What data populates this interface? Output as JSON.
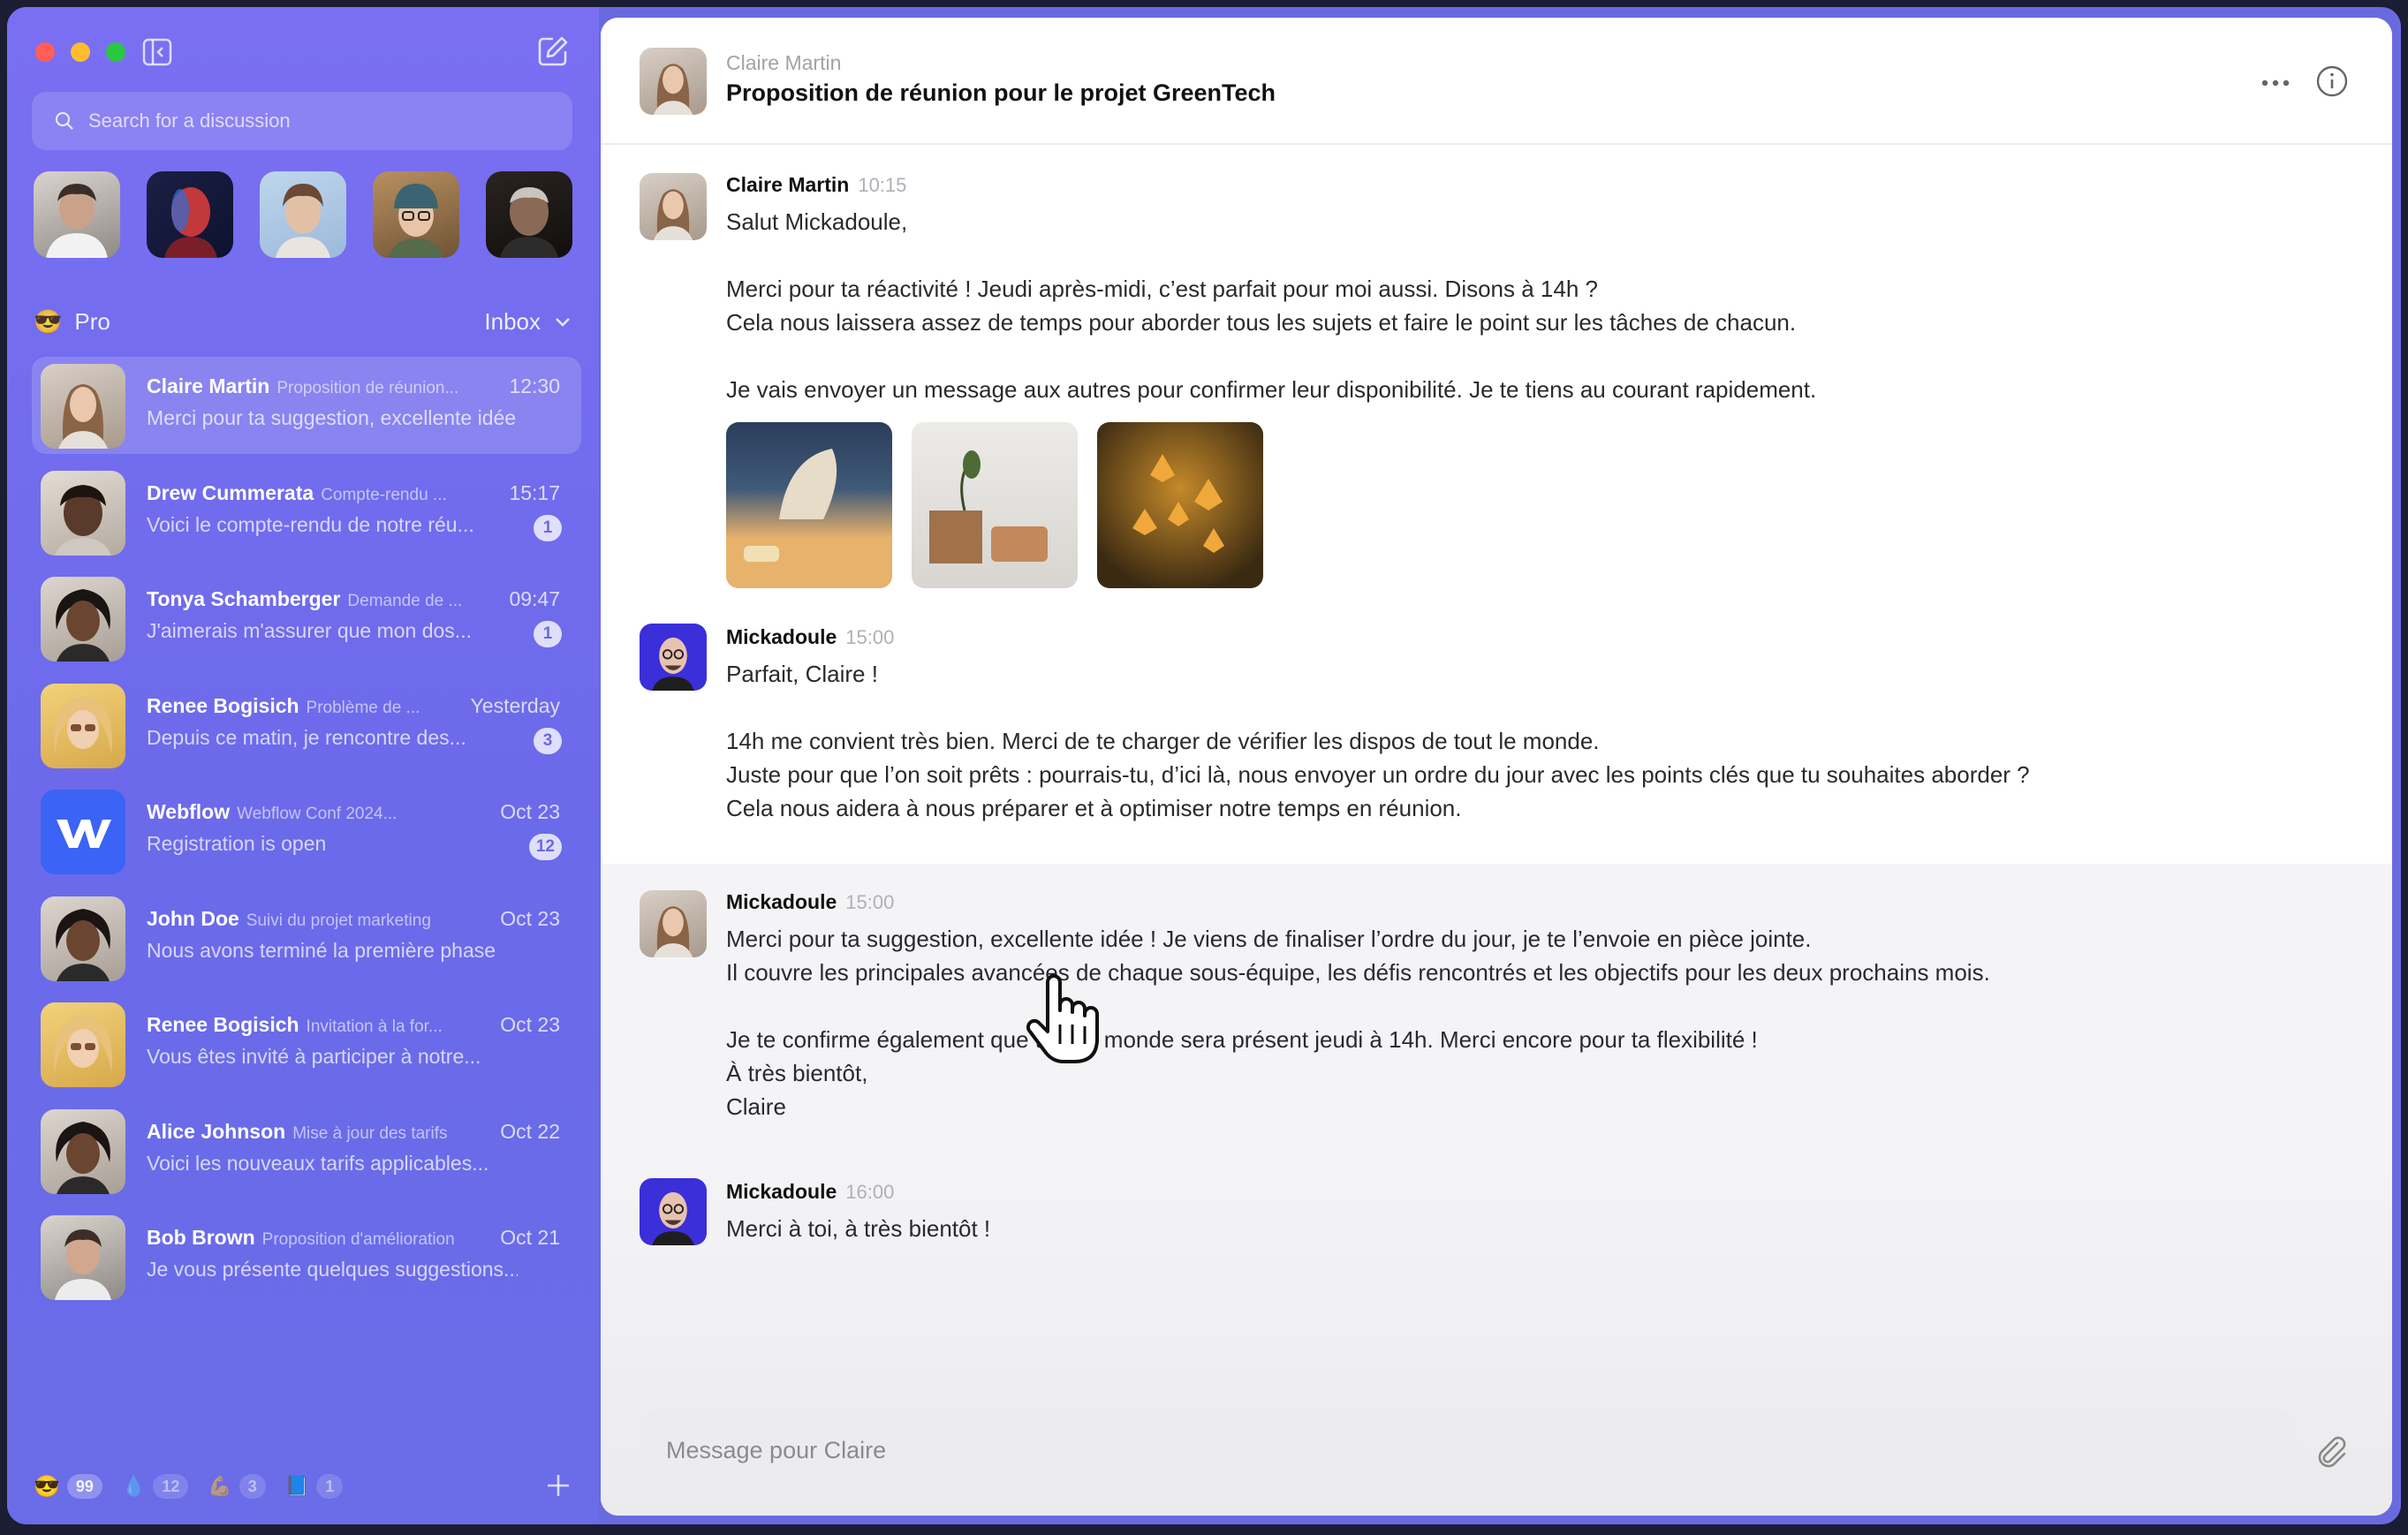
{
  "search": {
    "placeholder": "Search for a discussion"
  },
  "sidebar": {
    "group": {
      "emoji": "😎",
      "label": "Pro"
    },
    "inbox_label": "Inbox",
    "conversations": [
      {
        "name": "Claire Martin",
        "subject": "Proposition de réunion...",
        "time": "12:30",
        "preview": "Merci pour ta suggestion, excellente idée !",
        "badge": ""
      },
      {
        "name": "Drew Cummerata",
        "subject": "Compte-rendu ...",
        "time": "15:17",
        "preview": "Voici le compte-rendu de notre réu...",
        "badge": "1"
      },
      {
        "name": "Tonya Schamberger",
        "subject": "Demande de ...",
        "time": "09:47",
        "preview": "J'aimerais m'assurer que mon dos...",
        "badge": "1"
      },
      {
        "name": "Renee Bogisich",
        "subject": "Problème de ...",
        "time": "Yesterday",
        "preview": "Depuis ce matin, je rencontre des...",
        "badge": "3"
      },
      {
        "name": "Webflow",
        "subject": "Webflow Conf 2024...",
        "time": "Oct 23",
        "preview": "Registration is open",
        "badge": "12"
      },
      {
        "name": "John Doe",
        "subject": "Suivi du projet marketing",
        "time": "Oct 23",
        "preview": "Nous avons terminé la première phase",
        "badge": ""
      },
      {
        "name": "Renee Bogisich",
        "subject": "Invitation à la for...",
        "time": "Oct 23",
        "preview": "Vous êtes invité à participer à notre...",
        "badge": ""
      },
      {
        "name": "Alice Johnson",
        "subject": "Mise à jour des tarifs",
        "time": "Oct 22",
        "preview": "Voici les nouveaux tarifs applicables...",
        "badge": ""
      },
      {
        "name": "Bob Brown",
        "subject": "Proposition d'amélioration",
        "time": "Oct 21",
        "preview": "Je vous présente quelques suggestions...",
        "badge": ""
      }
    ],
    "bottom_groups": [
      {
        "emoji": "😎",
        "count": "99"
      },
      {
        "emoji": "💧",
        "count": "12"
      },
      {
        "emoji": "💪",
        "count": "3"
      },
      {
        "emoji": "📘",
        "count": "1"
      }
    ]
  },
  "thread": {
    "header_from": "Claire Martin",
    "header_title": "Proposition de réunion pour le projet GreenTech",
    "messages": [
      {
        "author": "Claire Martin",
        "time": "10:15",
        "body": "Salut Mickadoule,\n\nMerci pour ta réactivité ! Jeudi après-midi, c’est parfait pour moi aussi. Disons à 14h ?\nCela nous laissera assez de temps pour aborder tous les sujets et faire le point sur les tâches de chacun.\n\nJe vais envoyer un message aux autres pour confirmer leur disponibilité. Je te tiens au courant rapidement."
      },
      {
        "author": "Mickadoule",
        "time": "15:00",
        "body": "Parfait, Claire !\n\n14h me convient très bien. Merci de te charger de vérifier les dispos de tout le monde.\nJuste pour que l’on soit prêts : pourrais-tu, d’ici là, nous envoyer un ordre du jour avec les points clés que tu souhaites aborder ?\nCela nous aidera à nous préparer et à optimiser notre temps en réunion."
      },
      {
        "author": "Mickadoule",
        "time": "15:00",
        "body": "Merci pour ta suggestion, excellente idée ! Je viens de finaliser l’ordre du jour, je te l’envoie en pièce jointe.\nIl couvre les principales avancées de chaque sous-équipe, les défis rencontrés et les objectifs pour les deux prochains mois.\n\nJe te confirme également que tout le monde sera présent jeudi à 14h. Merci encore pour ta flexibilité !\nÀ très bientôt,\nClaire"
      },
      {
        "author": "Mickadoule",
        "time": "16:00",
        "body": "Merci à toi, à très bientôt !"
      }
    ]
  },
  "composer": {
    "placeholder": "Message pour Claire"
  },
  "colors": {
    "sidebar_bg": "#7a6ff2",
    "accent": "#6a6ae0",
    "main_bg": "#ffffff"
  }
}
